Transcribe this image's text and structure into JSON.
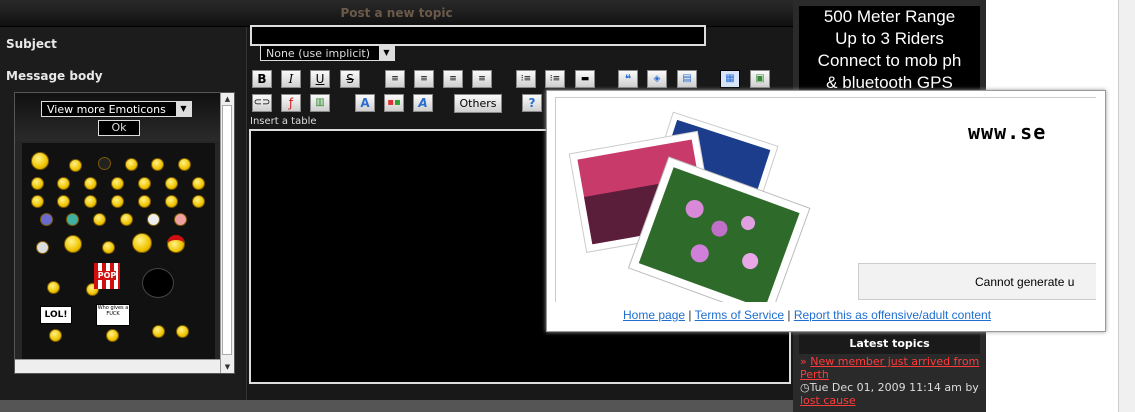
{
  "form": {
    "title": "Post a new topic",
    "subject_label": "Subject",
    "message_label": "Message body",
    "subject_value": "",
    "icon_select": "None (use implicit)",
    "insert_table_tip": "Insert a table",
    "others_button": "Others"
  },
  "emoticons": {
    "select_label": "View more Emoticons",
    "ok_button": "Ok",
    "sign_lol": "LOL!",
    "sign_who": "Who gives a FUCK",
    "popcorn_text": "POP"
  },
  "sidebar": {
    "ad_lines": [
      "500 Meter Range",
      "Up to 3 Riders",
      "Connect to mob ph",
      "& bluetooth GPS"
    ],
    "latest_heading": "Latest topics",
    "topic_title": "New member just arrived from Perth",
    "topic_date": "Tue Dec 01, 2009 11:14 am",
    "topic_by": "by",
    "topic_author": "lost cause"
  },
  "popup": {
    "brand": "www.se",
    "cannot_text": "Cannot generate u",
    "links": [
      "Home page",
      "Terms of Service",
      "Report this as offensive/adult content"
    ],
    "separator": "|"
  },
  "colors": {
    "accent_link": "#ff3b3b",
    "popup_link": "#1e6fd0",
    "title_color": "#6b5a4a"
  }
}
